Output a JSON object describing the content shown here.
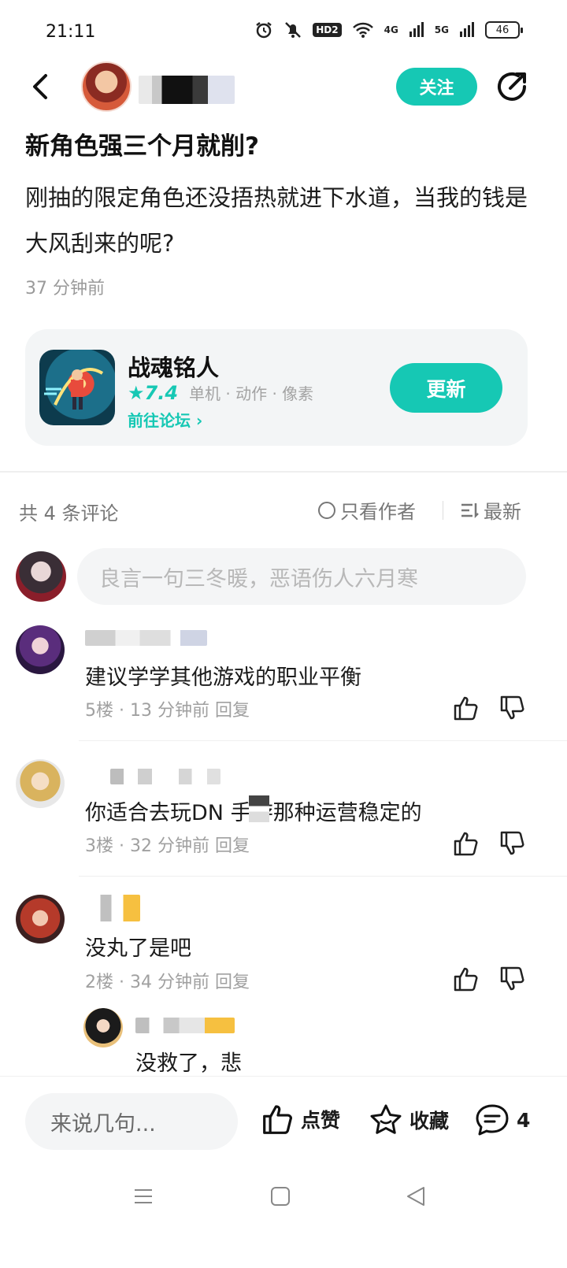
{
  "status": {
    "time": "21:11",
    "battery": "46",
    "hd": "HD2",
    "net1": "4G",
    "net2": "5G"
  },
  "header": {
    "follow_label": "关注"
  },
  "post": {
    "title": "新角色强三个月就削?",
    "body": "刚抽的限定角色还没捂热就进下水道，当我的钱是大风刮来的呢?",
    "time": "37 分钟前"
  },
  "game_card": {
    "name": "战魂铭人",
    "rating": "★7.4",
    "tags": "单机 · 动作 · 像素",
    "forum_link": "前往论坛 ›",
    "update_label": "更新"
  },
  "comments_header": {
    "count": "共 4 条评论",
    "author_only": "只看作者",
    "sort": "最新"
  },
  "comment_input_placeholder": "良言一句三冬暖，恶语伤人六月寒",
  "comments": [
    {
      "text": "建议学学其他游戏的职业平衡",
      "meta": "5楼 · 13 分钟前   回复"
    },
    {
      "text": "你适合去玩DN  手游那种运营稳定的",
      "meta": "3楼 · 32 分钟前   回复"
    },
    {
      "text": "没丸了是吧",
      "meta": "2楼 · 34 分钟前   回复"
    }
  ],
  "reply": {
    "text": "没救了，悲"
  },
  "bottom_bar": {
    "input_placeholder": "来说几句...",
    "like_label": "点赞",
    "fav_label": "收藏",
    "comment_count": "4"
  },
  "colors": {
    "accent": "#16c8b4"
  }
}
